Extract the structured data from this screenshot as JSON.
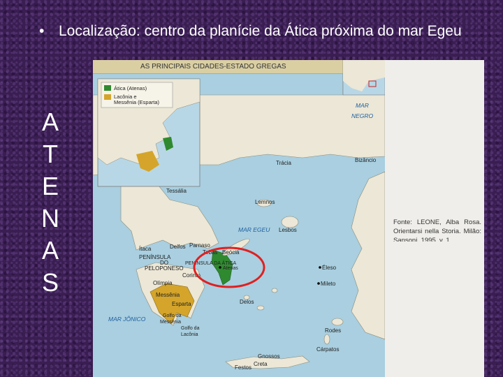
{
  "slide": {
    "bullet_symbol": "•",
    "bullet_text": "Localização: centro da planície da Ática próxima do mar Egeu",
    "vertical_letters": [
      "A",
      "T",
      "E",
      "N",
      "A",
      "S"
    ]
  },
  "map": {
    "title": "AS PRINCIPAIS CIDADES-ESTADO GREGAS",
    "legend": [
      {
        "label": "Ática (Atenas)",
        "color": "#2f8a2f"
      },
      {
        "label": "Lacônia e",
        "color": "#d4a52a"
      },
      {
        "label": "Messênia (Esparta)",
        "color": ""
      }
    ],
    "labels": {
      "mar_negro_1": "MAR",
      "mar_negro_2": "NEGRO",
      "bizancio": "Bizâncio",
      "tracia": "Trácia",
      "tessalia": "Tessália",
      "lemnos": "Lemnos",
      "mar_egeu": "MAR EGEU",
      "lesbos": "Lesbos",
      "itaca": "Ítaca",
      "delfos": "Delfos",
      "parnaso": "Parnaso",
      "tebas": "Tebas",
      "beocia": "Beócia",
      "peninsula_peloponeso_1": "PENÍNSULA",
      "peninsula_peloponeso_2": "DO",
      "peninsula_peloponeso_3": "PELOPONESO",
      "peninsula_atica": "PENÍNSULA DA ÁTICA",
      "atenas": "Atenas",
      "corinto": "Corinto",
      "olimpia": "Olímpia",
      "messenia": "Messênia",
      "esparta": "Esparta",
      "eleso": "Éleso",
      "mileto": "Mileto",
      "delos": "Delos",
      "mar_jonico": "MAR JÔNICO",
      "golfo_messenia_1": "Golfo da",
      "golfo_messenia_2": "Messênia",
      "golfo_laconia_1": "Golfo da",
      "golfo_laconia_2": "Lacônia",
      "rodes": "Rodes",
      "carpatos": "Cárpatos",
      "gnossos": "Gnossos",
      "festos": "Festos",
      "creta": "Creta"
    },
    "source_text": "Fonte: LEONE, Alba Rosa. Orientarsi nella Storia. Milão: Sansoni, 1995. v. 1."
  },
  "colors": {
    "background": "#3a1e52",
    "sea": "#a9cfe0",
    "land": "#ece7d6",
    "attica": "#2f8a2f",
    "laconia": "#d4a52a",
    "highlight_circle": "#e02020"
  }
}
